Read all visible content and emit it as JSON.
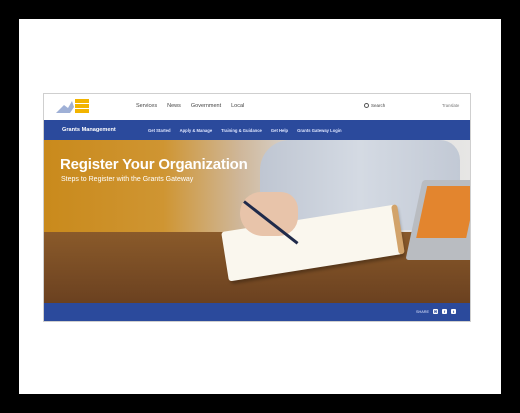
{
  "header": {
    "nav": [
      "Services",
      "News",
      "Government",
      "Local"
    ],
    "search_label": "Search",
    "language_label": "Translate"
  },
  "bluebar": {
    "title": "Grants Management",
    "links": [
      "Get Started",
      "Apply & Manage",
      "Training & Guidance",
      "Get Help",
      "Grants Gateway Login"
    ]
  },
  "hero": {
    "title": "Register Your Organization",
    "subtitle": "Steps to Register with the Grants Gateway"
  },
  "footer": {
    "share_label": "SHARE"
  },
  "colors": {
    "brand_blue": "#2b4a9c",
    "frame": "#000000",
    "mat": "#ffffff"
  }
}
